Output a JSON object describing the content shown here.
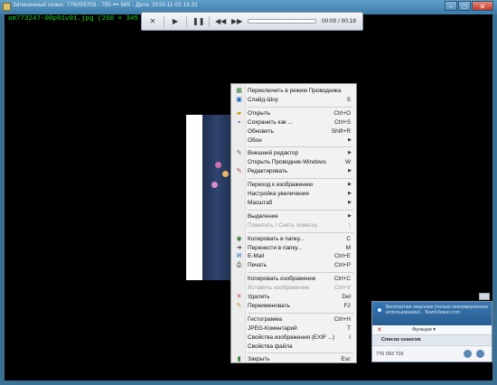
{
  "window": {
    "title": "Запасенный сеанс: 776093703 - 755 ••• 565 - Дата: 2010-11-02 13.31",
    "filename": "om773247-00p01v01.jpg (260 × 345 = 0.1",
    "buttons": [
      "minimize",
      "maximize",
      "close"
    ]
  },
  "player": {
    "time": "00:00 / 00:18",
    "progress": 0.0
  },
  "menu": {
    "items": [
      {
        "label": "Переключить в режим Проводника",
        "shortcut": "",
        "icon": "explorer-icon",
        "submenu": false,
        "disabled": false
      },
      {
        "label": "Слайд-Шоу",
        "shortcut": "S",
        "icon": "slideshow-icon",
        "submenu": false,
        "disabled": false
      },
      {
        "sep": true
      },
      {
        "label": "Открыть",
        "shortcut": "Ctrl+O",
        "icon": "open-icon",
        "submenu": false,
        "disabled": false
      },
      {
        "label": "Сохранить как ...",
        "shortcut": "Ctrl+S",
        "icon": "save-icon",
        "submenu": false,
        "disabled": false
      },
      {
        "label": "Обновить",
        "shortcut": "Shift+R",
        "icon": "",
        "submenu": false,
        "disabled": false
      },
      {
        "label": "Обои",
        "shortcut": "",
        "icon": "",
        "submenu": true,
        "disabled": false
      },
      {
        "sep": true
      },
      {
        "label": "Внешний редактор",
        "shortcut": "",
        "icon": "editor-icon",
        "submenu": true,
        "disabled": false
      },
      {
        "label": "Открыть Проводник-Windows",
        "shortcut": "W",
        "icon": "",
        "submenu": false,
        "disabled": false
      },
      {
        "label": "Редактировать",
        "shortcut": "",
        "icon": "edit-icon",
        "submenu": true,
        "disabled": false
      },
      {
        "sep": true
      },
      {
        "label": "Переход к изображению",
        "shortcut": "",
        "icon": "",
        "submenu": true,
        "disabled": false
      },
      {
        "label": "Настройка увеличения",
        "shortcut": "",
        "icon": "",
        "submenu": true,
        "disabled": false
      },
      {
        "label": "Масштаб",
        "shortcut": "",
        "icon": "",
        "submenu": true,
        "disabled": false
      },
      {
        "sep": true
      },
      {
        "label": "Выделение",
        "shortcut": "",
        "icon": "",
        "submenu": true,
        "disabled": false
      },
      {
        "label": "Пометить / Снять пометку",
        "shortcut": "\\",
        "icon": "",
        "submenu": false,
        "disabled": true
      },
      {
        "sep": true
      },
      {
        "label": "Копировать в папку...",
        "shortcut": "C",
        "icon": "copy-to-folder-icon",
        "submenu": false,
        "disabled": false
      },
      {
        "label": "Перенести в папку...",
        "shortcut": "M",
        "icon": "move-to-folder-icon",
        "submenu": false,
        "disabled": false
      },
      {
        "label": "E-Mail",
        "shortcut": "Ctrl+E",
        "icon": "email-icon",
        "submenu": false,
        "disabled": false
      },
      {
        "label": "Печать",
        "shortcut": "Ctrl+P",
        "icon": "print-icon",
        "submenu": false,
        "disabled": false
      },
      {
        "sep": true
      },
      {
        "label": "Копировать изображение",
        "shortcut": "Ctrl+C",
        "icon": "",
        "submenu": false,
        "disabled": false
      },
      {
        "label": "Вставить изображение",
        "shortcut": "Ctrl+V",
        "icon": "",
        "submenu": false,
        "disabled": true
      },
      {
        "label": "Удалить",
        "shortcut": "Del",
        "icon": "delete-icon",
        "submenu": false,
        "disabled": false
      },
      {
        "label": "Переименовать",
        "shortcut": "F2",
        "icon": "rename-icon",
        "submenu": false,
        "disabled": false
      },
      {
        "sep": true
      },
      {
        "label": "Гистограмма",
        "shortcut": "Ctrl+H",
        "icon": "",
        "submenu": false,
        "disabled": false
      },
      {
        "label": "JPEG-Коментарий",
        "shortcut": "T",
        "icon": "",
        "submenu": false,
        "disabled": false
      },
      {
        "label": "Свойства изображения (EXIF ...)",
        "shortcut": "I",
        "icon": "",
        "submenu": false,
        "disabled": false
      },
      {
        "label": "Свойства файла",
        "shortcut": "",
        "icon": "",
        "submenu": false,
        "disabled": false
      },
      {
        "sep": true
      },
      {
        "label": "Закрыть",
        "shortcut": "Esc",
        "icon": "close-door-icon",
        "submenu": false,
        "disabled": false
      }
    ]
  },
  "teamviewer": {
    "notice": "Бесплатная лицензия (только некоммерческое использование) - TeamViewer.com",
    "functions_label": "Функции",
    "sessions_label": "Список сеансов",
    "session_id": "776 093 703"
  },
  "colors": {
    "filename_text": "#21d421",
    "titlebar": "#4b8bbd",
    "menu_bg": "#f2f2f2"
  }
}
